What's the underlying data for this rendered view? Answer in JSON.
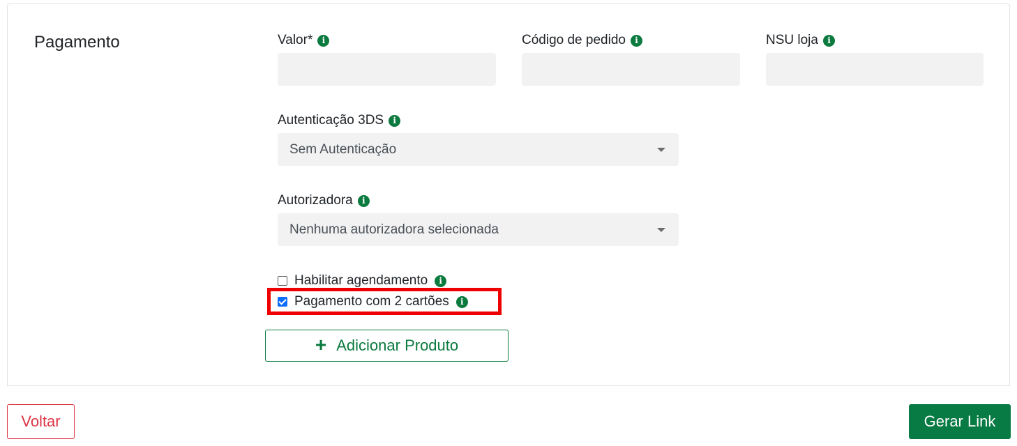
{
  "section": {
    "title": "Pagamento"
  },
  "fields": {
    "valor": {
      "label": "Valor*",
      "value": ""
    },
    "codigo_pedido": {
      "label": "Código de pedido",
      "value": ""
    },
    "nsu_loja": {
      "label": "NSU loja",
      "value": ""
    },
    "autenticacao": {
      "label": "Autenticação 3DS",
      "selected": "Sem Autenticação"
    },
    "autorizadora": {
      "label": "Autorizadora",
      "selected": "Nenhuma autorizadora selecionada"
    }
  },
  "options": {
    "agendamento": {
      "label": "Habilitar agendamento",
      "checked": false
    },
    "dois_cartoes": {
      "label": "Pagamento com 2 cartões",
      "checked": true
    }
  },
  "actions": {
    "add_product": "Adicionar Produto",
    "add_icon": "+",
    "back": "Voltar",
    "generate": "Gerar Link"
  },
  "icons": {
    "info": "i"
  },
  "colors": {
    "brand_green": "#087a44",
    "danger": "#dc3545",
    "highlight": "#ee0000",
    "input_bg": "#f2f2f2"
  }
}
